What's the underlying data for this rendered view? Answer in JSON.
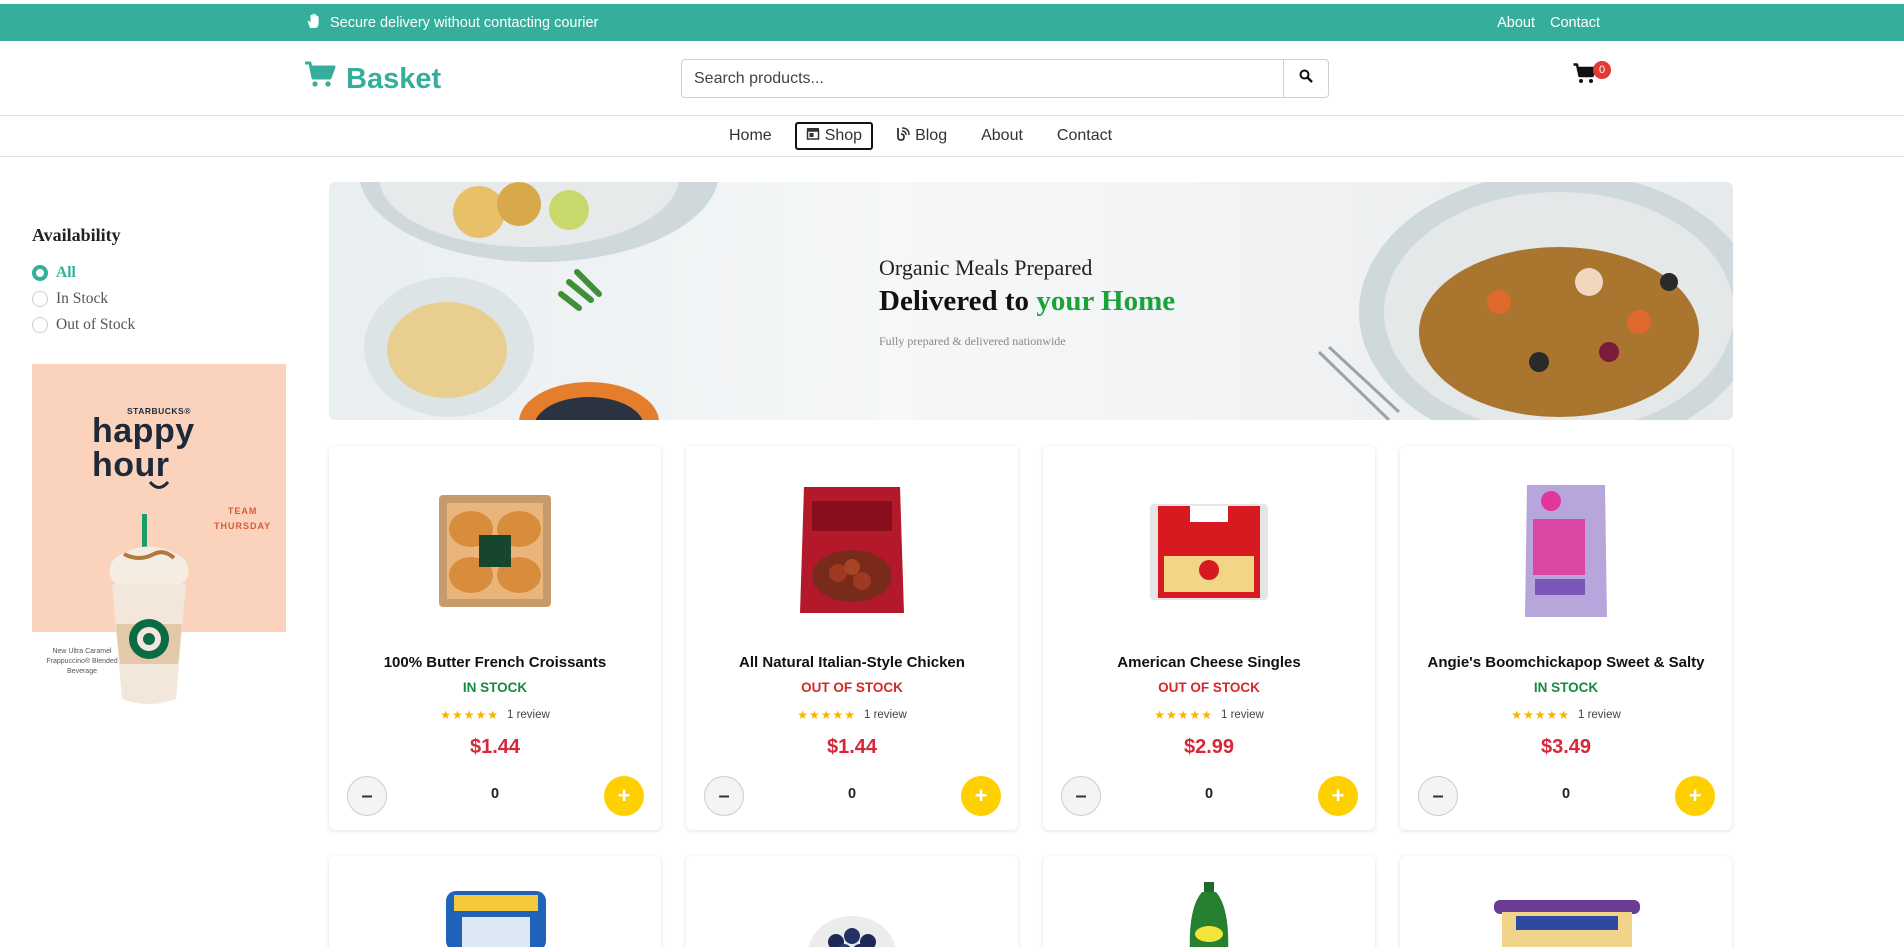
{
  "topbar": {
    "message": "Secure delivery without contacting courier",
    "links": [
      "About",
      "Contact"
    ],
    "bg_color": "#35ae9c"
  },
  "header": {
    "logo_text": "Basket",
    "logo_icon": "cart-icon",
    "search_placeholder": "Search products...",
    "search_icon": "search-icon",
    "cart_count": "0"
  },
  "nav": {
    "items": [
      {
        "label": "Home",
        "icon": ""
      },
      {
        "label": "Shop",
        "icon": "store-icon"
      },
      {
        "label": "Blog",
        "icon": "blog-icon"
      },
      {
        "label": "About",
        "icon": ""
      },
      {
        "label": "Contact",
        "icon": ""
      }
    ],
    "active": "Shop"
  },
  "sidebar": {
    "title": "Availability",
    "options": [
      "All",
      "In Stock",
      "Out of Stock"
    ],
    "selected": "All",
    "promo": {
      "brand": "STARBUCKS®",
      "headline_1": "happy",
      "headline_2": "hour",
      "team": "TEAM",
      "day": "THURSDAY",
      "caption": "New Ultra Caramel Frappuccino® Blended Beverage"
    }
  },
  "banner": {
    "line1": "Organic Meals Prepared",
    "line2_prefix": "Delivered to ",
    "line2_highlight": "your Home",
    "line3": "Fully prepared & delivered nationwide"
  },
  "products": [
    {
      "name": "100% Butter French Croissants",
      "stock": "IN STOCK",
      "reviews": "1 review",
      "price": "$1.44",
      "qty": "0"
    },
    {
      "name": "All Natural Italian-Style Chicken",
      "stock": "OUT OF STOCK",
      "reviews": "1 review",
      "price": "$1.44",
      "qty": "0"
    },
    {
      "name": "American Cheese Singles",
      "stock": "OUT OF STOCK",
      "reviews": "1 review",
      "price": "$2.99",
      "qty": "0"
    },
    {
      "name": "Angie's Boomchickapop Sweet & Salty",
      "stock": "IN STOCK",
      "reviews": "1 review",
      "price": "$3.49",
      "qty": "0"
    }
  ],
  "stars": "★★★★★"
}
